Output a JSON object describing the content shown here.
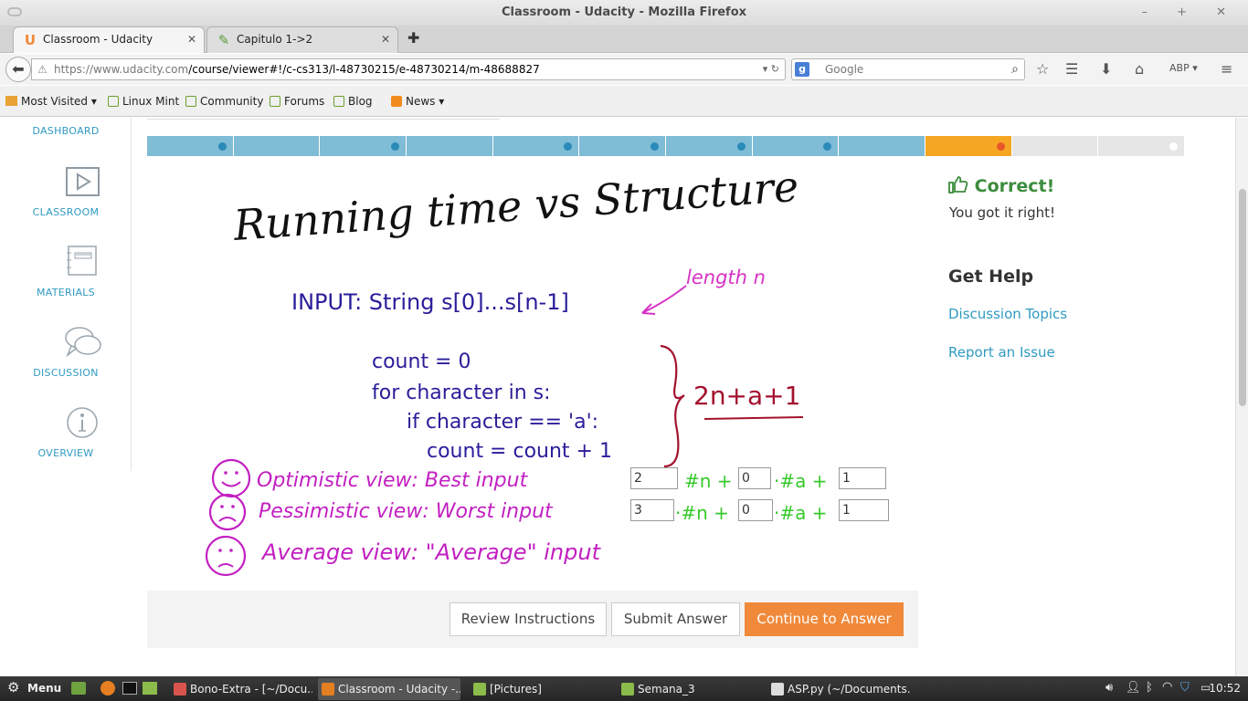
{
  "window": {
    "title": "Classroom - Udacity - Mozilla Firefox",
    "controls": "– + ✕"
  },
  "tabs": [
    {
      "label": "Classroom - Udacity",
      "icon": "udacity-U-icon",
      "icon_glyph": "U",
      "active": true
    },
    {
      "label": "Capitulo 1->2",
      "icon": "page-icon",
      "icon_glyph": "✎",
      "active": false
    }
  ],
  "nav": {
    "url_domain": "https://www.udacity.com",
    "url_path": "/course/viewer#!/c-cs313/l-48730215/e-48730214/m-48688827",
    "search_placeholder": "Google",
    "search_engine": "g"
  },
  "bookmarks": [
    {
      "label": "Most Visited",
      "dropdown": true
    },
    {
      "label": "Linux Mint"
    },
    {
      "label": "Community"
    },
    {
      "label": "Forums"
    },
    {
      "label": "Blog"
    },
    {
      "label": "News",
      "dropdown": true
    }
  ],
  "sidebar": {
    "items": [
      {
        "label": "DASHBOARD"
      },
      {
        "label": "CLASSROOM"
      },
      {
        "label": "MATERIALS"
      },
      {
        "label": "DISCUSSION"
      },
      {
        "label": "OVERVIEW"
      }
    ]
  },
  "progress": {
    "segments": [
      {
        "state": "done",
        "dot": true
      },
      {
        "state": "done",
        "dot": false
      },
      {
        "state": "done",
        "dot": true
      },
      {
        "state": "done",
        "dot": false
      },
      {
        "state": "done",
        "dot": true
      },
      {
        "state": "done",
        "dot": true
      },
      {
        "state": "done",
        "dot": true
      },
      {
        "state": "done",
        "dot": true
      },
      {
        "state": "done",
        "dot": false
      },
      {
        "state": "current",
        "dot": true
      },
      {
        "state": "todo",
        "dot": false
      },
      {
        "state": "todo",
        "dot": true
      }
    ],
    "colors": {
      "done": "#7fbcd6",
      "current": "#f5a623",
      "todo": "#e6e6e6",
      "dot_done": "#2a8ab8",
      "dot_current": "#e8572a",
      "dot_todo": "#ffffff"
    }
  },
  "whiteboard": {
    "title": "Running time vs Structure",
    "input_line": "INPUT: String s[0]...s[n-1]",
    "length_note": "length n",
    "code": [
      "count = 0",
      "for character in s:",
      "if character == 'a':",
      "count = count + 1"
    ],
    "formula": "2n+a+1",
    "views": [
      "Optimistic view: Best input",
      "Pessimistic view: Worst input",
      "Average view: \"Average\" input"
    ],
    "row1_terms": [
      "#n +",
      "·#a +"
    ],
    "row2_terms": [
      "·#n +",
      "·#a +"
    ],
    "answers": {
      "opt_n": "2",
      "opt_a": "0",
      "opt_c": "1",
      "pes_n": "3",
      "pes_a": "0",
      "pes_c": "1"
    }
  },
  "buttons": {
    "review": "Review Instructions",
    "submit": "Submit Answer",
    "continue": "Continue to Answer"
  },
  "feedback": {
    "title": "Correct!",
    "message": "You got it right!"
  },
  "help": {
    "title": "Get Help",
    "links": [
      "Discussion Topics",
      "Report an Issue"
    ]
  },
  "taskbar": {
    "menu": "Menu",
    "windows": [
      {
        "label": "Bono-Extra - [~/Docu...",
        "active": false
      },
      {
        "label": "Classroom - Udacity -...",
        "active": true
      },
      {
        "label": "[Pictures]",
        "active": false
      },
      {
        "label": "Semana_3",
        "active": false
      },
      {
        "label": "ASP.py (~/Documents...",
        "active": false
      }
    ],
    "clock": "10:52"
  }
}
